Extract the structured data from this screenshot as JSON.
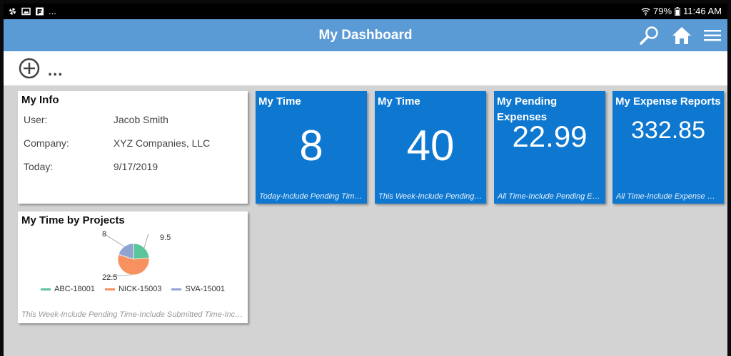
{
  "status_bar": {
    "left_dots": "...",
    "battery": "79%",
    "time": "11:46 AM"
  },
  "header": {
    "title": "My Dashboard",
    "color": "#5b9bd5"
  },
  "toolbar": {
    "more": "..."
  },
  "my_info": {
    "title": "My Info",
    "rows": [
      {
        "label": "User:",
        "value": "Jacob Smith"
      },
      {
        "label": "Company:",
        "value": "XYZ Companies, LLC"
      },
      {
        "label": "Today:",
        "value": "9/17/2019"
      }
    ]
  },
  "tiles": [
    {
      "title": "My Time",
      "value": "8",
      "footer": "Today-Include Pending Time-Include Submitted Time"
    },
    {
      "title": "My Time",
      "value": "40",
      "footer": "This Week-Include Pending Time-Include Submitted Time"
    },
    {
      "title": "My Pending Expenses",
      "value": "22.99",
      "footer": "All Time-Include Pending Expenses"
    },
    {
      "title": "My Expense Reports",
      "value": "332.85",
      "footer": "All Time-Include Expense Reports"
    }
  ],
  "tile_color": "#0e78d0",
  "projects": {
    "title": "My Time by Projects",
    "footer": "This Week-Include Pending Time-Include Submitted Time-Include Approved Time"
  },
  "chart_data": {
    "type": "pie",
    "title": "My Time by Projects",
    "categories": [
      "ABC-18001",
      "NICK-15003",
      "SVA-15001"
    ],
    "values": [
      9.5,
      22.5,
      8
    ],
    "colors": [
      "#5cc49a",
      "#f7915f",
      "#8fa3d0"
    ],
    "legend": "bottom"
  }
}
